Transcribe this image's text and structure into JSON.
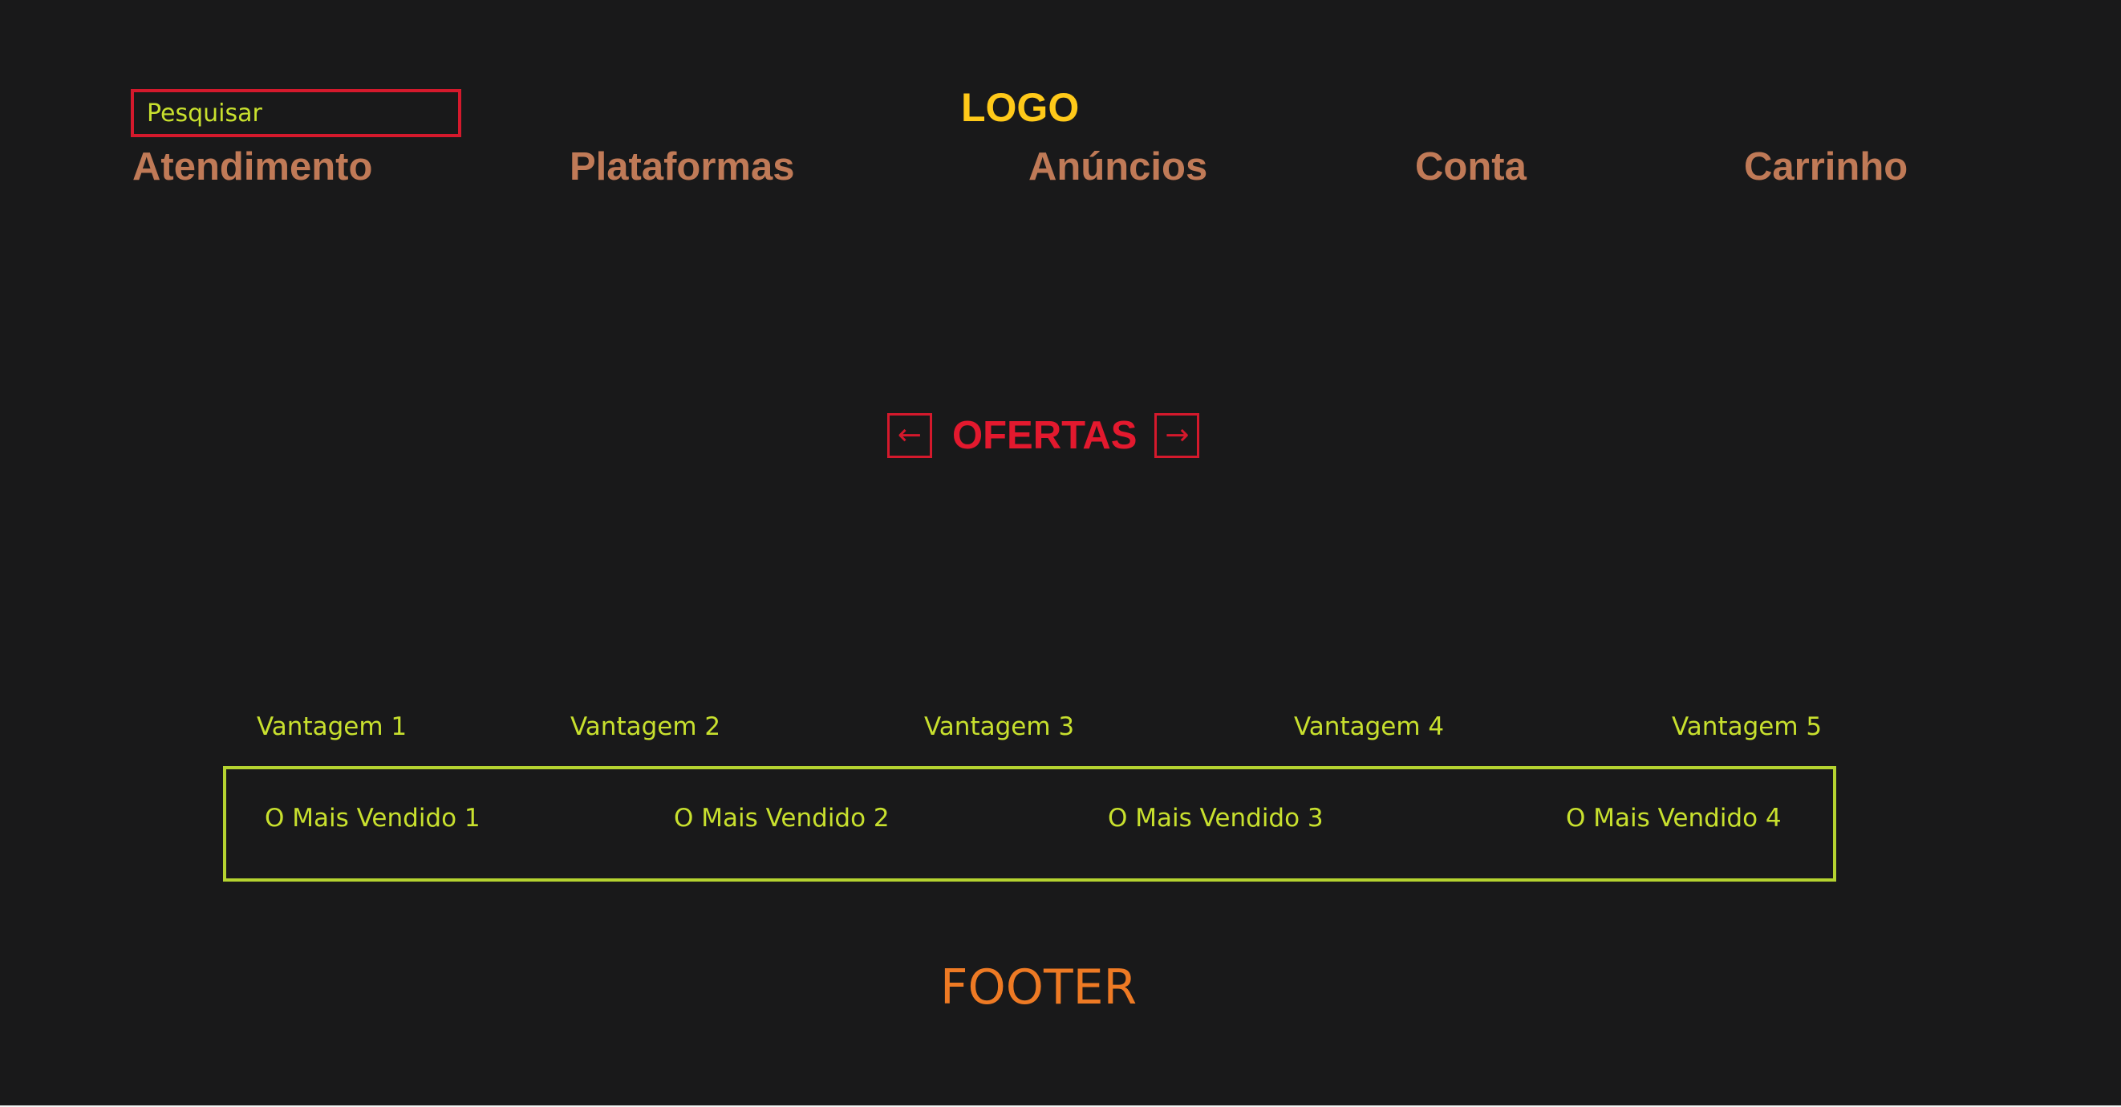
{
  "search": {
    "placeholder": "Pesquisar"
  },
  "header": {
    "logo": "LOGO"
  },
  "nav": {
    "items": [
      {
        "label": "Atendimento"
      },
      {
        "label": "Plataformas"
      },
      {
        "label": "Anúncios"
      },
      {
        "label": "Conta"
      },
      {
        "label": "Carrinho"
      }
    ]
  },
  "offers": {
    "prev_icon": "←",
    "title": "OFERTAS",
    "next_icon": "→"
  },
  "advantages": [
    {
      "label": "Vantagem 1"
    },
    {
      "label": "Vantagem 2"
    },
    {
      "label": "Vantagem 3"
    },
    {
      "label": "Vantagem 4"
    },
    {
      "label": "Vantagem 5"
    }
  ],
  "bestsellers": [
    {
      "label": "O Mais Vendido 1"
    },
    {
      "label": "O Mais Vendido 2"
    },
    {
      "label": "O Mais Vendido 3"
    },
    {
      "label": "O Mais Vendido 4"
    }
  ],
  "footer": {
    "label": "FOOTER"
  },
  "colors": {
    "background": "#19191a",
    "logo": "#ffc919",
    "nav": "#c07a57",
    "accent_red": "#d4192c",
    "accent_green": "#c8e02e",
    "footer": "#ee7a24"
  }
}
